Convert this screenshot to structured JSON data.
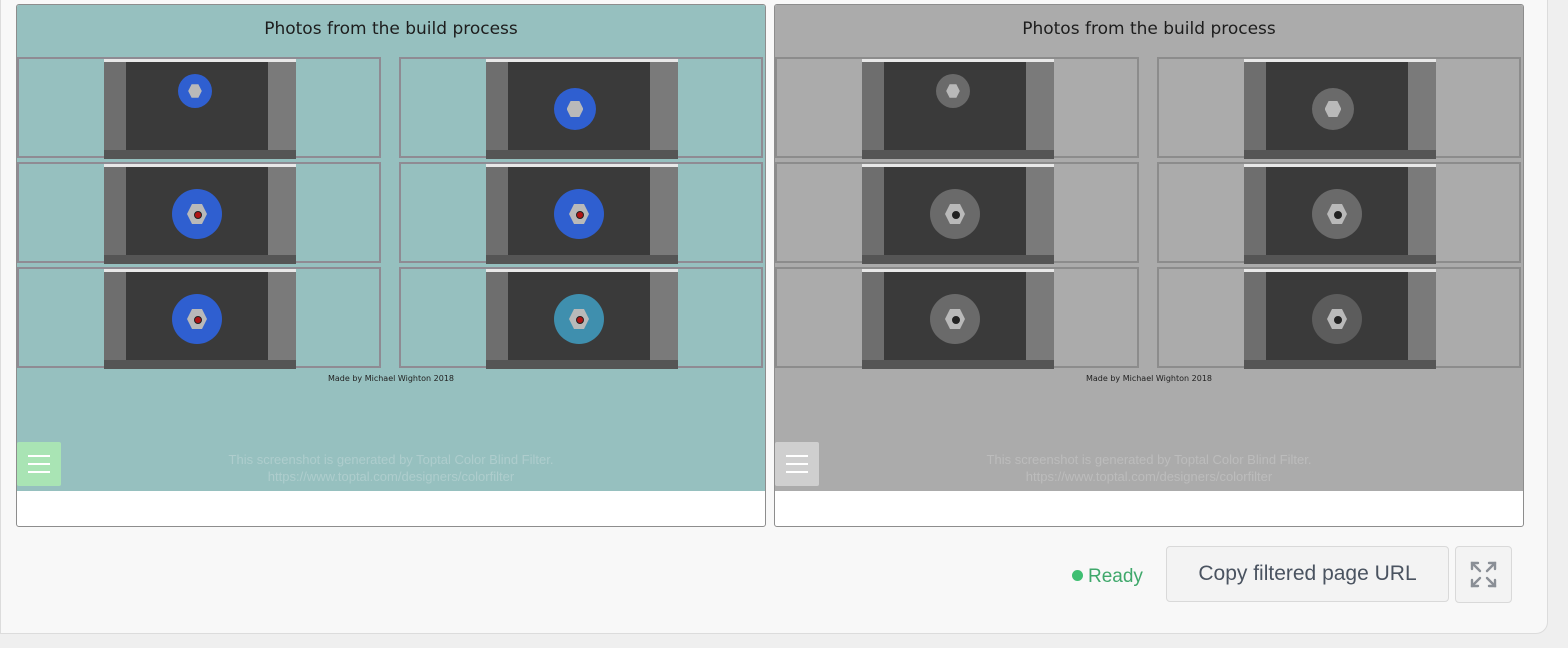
{
  "panes": [
    {
      "variant": "original",
      "title": "Photos from the build process",
      "credit": "Made by Michael Wighton 2018",
      "watermark_line1": "This screenshot is generated by Toptal Color Blind Filter.",
      "watermark_line2": "https://www.toptal.com/designers/colorfilter",
      "orb_color": "#2f5fd0",
      "menu_icon": "hamburger-menu-icon"
    },
    {
      "variant": "filtered",
      "title": "Photos from the build process",
      "credit": "Made by Michael Wighton 2018",
      "watermark_line1": "This screenshot is generated by Toptal Color Blind Filter.",
      "watermark_line2": "https://www.toptal.com/designers/colorfilter",
      "orb_color": "#6a6a6a",
      "menu_icon": "hamburger-menu-icon"
    }
  ],
  "status": {
    "label": "Ready",
    "color": "#3fa86b"
  },
  "actions": {
    "copy_label": "Copy filtered page URL",
    "expand_icon": "expand-icon"
  }
}
